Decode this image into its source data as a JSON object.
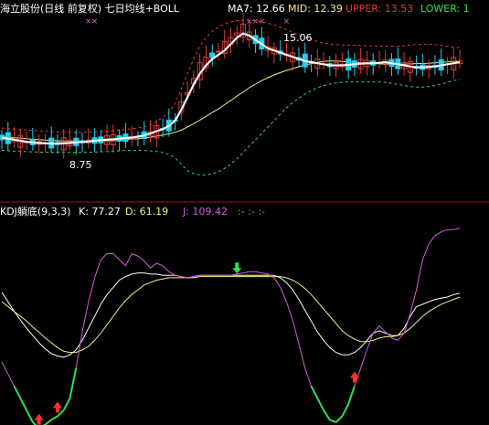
{
  "header": {
    "stock_title": "海立股份(日线 前复权) 七日均线+BOLL",
    "ma7": "MA7: 12.66",
    "mid": "MID: 12.39",
    "upper": "UPPER: 13.53",
    "lower": "LOWER: 1"
  },
  "sub_header": {
    "title": "KDJ躺底(9,3,3)",
    "k": "K: 77.27",
    "d": "D: 61.19",
    "j": "J: 109.42",
    "extra": ":- :- :-"
  },
  "annotations": {
    "high_label": "15.06",
    "low_label": "8.75"
  },
  "colors": {
    "up": "#e03a3a",
    "down": "#20d0f0",
    "ma7": "#ffffff",
    "mid": "#f0f080",
    "upper": "#e03a3a",
    "lower": "#30e050",
    "k": "#ffffff",
    "d": "#f0f080",
    "j": "#d85ad8",
    "j_low": "#30e050",
    "signal_up": "#ff3030",
    "signal_green": "#30e050"
  },
  "chart_data": [
    {
      "type": "candlestick",
      "title": "海立股份(日线 前复权) 七日均线+BOLL",
      "ylim": [
        7.0,
        15.6
      ],
      "series": [
        {
          "name": "MA7",
          "values": [
            9.9,
            9.85,
            9.8,
            9.75,
            9.7,
            9.68,
            9.65,
            9.63,
            9.62,
            9.62,
            9.63,
            9.65,
            9.68,
            9.7,
            9.72,
            9.75,
            9.78,
            9.8,
            9.82,
            9.85,
            9.88,
            9.9,
            9.95,
            10.0,
            10.1,
            10.2,
            10.3,
            10.45,
            10.7,
            11.2,
            11.8,
            12.4,
            12.9,
            13.3,
            13.6,
            13.8,
            14.0,
            14.3,
            14.6,
            14.8,
            14.7,
            14.5,
            14.3,
            14.1,
            14.0,
            13.9,
            13.8,
            13.7,
            13.6,
            13.5,
            13.45,
            13.4,
            13.35,
            13.3,
            13.3,
            13.3,
            13.32,
            13.35,
            13.38,
            13.4,
            13.4,
            13.42,
            13.45,
            13.4,
            13.35,
            13.3,
            13.25,
            13.2,
            13.2,
            13.22,
            13.25,
            13.3,
            13.35,
            13.4,
            13.45
          ]
        },
        {
          "name": "MID",
          "values": [
            9.95,
            9.92,
            9.9,
            9.88,
            9.85,
            9.82,
            9.8,
            9.78,
            9.76,
            9.75,
            9.74,
            9.73,
            9.72,
            9.72,
            9.72,
            9.73,
            9.74,
            9.75,
            9.76,
            9.78,
            9.8,
            9.82,
            9.85,
            9.88,
            9.92,
            9.97,
            10.02,
            10.08,
            10.15,
            10.25,
            10.4,
            10.55,
            10.72,
            10.9,
            11.08,
            11.25,
            11.45,
            11.65,
            11.85,
            12.05,
            12.25,
            12.42,
            12.58,
            12.72,
            12.85,
            12.96,
            13.06,
            13.15,
            13.24,
            13.32,
            13.38,
            13.44,
            13.48,
            13.5,
            13.5,
            13.48,
            13.46,
            13.44,
            13.42,
            13.4,
            13.38,
            13.37,
            13.36,
            13.36,
            13.36,
            13.36,
            13.37,
            13.38,
            13.39,
            13.4,
            13.42,
            13.44,
            13.46,
            13.48,
            13.5
          ]
        },
        {
          "name": "UPPER",
          "values": [
            10.35,
            10.32,
            10.3,
            10.28,
            10.26,
            10.24,
            10.22,
            10.2,
            10.18,
            10.17,
            10.16,
            10.15,
            10.15,
            10.15,
            10.16,
            10.17,
            10.18,
            10.2,
            10.22,
            10.25,
            10.28,
            10.32,
            10.36,
            10.4,
            10.5,
            10.65,
            10.85,
            11.1,
            11.5,
            12.2,
            12.9,
            13.6,
            14.2,
            14.6,
            14.9,
            15.1,
            15.25,
            15.35,
            15.4,
            15.42,
            15.42,
            15.4,
            15.35,
            15.28,
            15.2,
            15.1,
            14.98,
            14.85,
            14.72,
            14.6,
            14.5,
            14.42,
            14.35,
            14.3,
            14.28,
            14.26,
            14.25,
            14.24,
            14.23,
            14.22,
            14.21,
            14.2,
            14.2,
            14.2,
            14.2,
            14.22,
            14.25,
            14.28,
            14.3,
            14.3,
            14.28,
            14.24,
            14.2,
            14.16,
            14.13
          ]
        },
        {
          "name": "LOWER",
          "values": [
            9.3,
            9.28,
            9.26,
            9.25,
            9.24,
            9.23,
            9.22,
            9.21,
            9.2,
            9.2,
            9.2,
            9.2,
            9.2,
            9.2,
            9.21,
            9.22,
            9.23,
            9.24,
            9.26,
            9.28,
            9.3,
            9.3,
            9.3,
            9.3,
            9.28,
            9.25,
            9.2,
            9.1,
            8.95,
            8.65,
            8.35,
            8.2,
            8.15,
            8.15,
            8.2,
            8.3,
            8.45,
            8.65,
            8.9,
            9.2,
            9.5,
            9.8,
            10.1,
            10.4,
            10.7,
            11.0,
            11.3,
            11.55,
            11.75,
            11.95,
            12.1,
            12.25,
            12.35,
            12.42,
            12.47,
            12.5,
            12.52,
            12.52,
            12.52,
            12.52,
            12.52,
            12.52,
            12.5,
            12.45,
            12.4,
            12.35,
            12.3,
            12.28,
            12.28,
            12.3,
            12.35,
            12.42,
            12.5,
            12.58,
            12.63
          ]
        }
      ]
    },
    {
      "type": "line",
      "title": "KDJ躺底(9,3,3)",
      "ylim": [
        -30,
        140
      ],
      "series": [
        {
          "name": "K",
          "values": [
            78,
            70,
            62,
            55,
            48,
            42,
            36,
            31,
            27,
            25,
            24,
            26,
            30,
            38,
            48,
            58,
            68,
            76,
            82,
            88,
            91,
            93,
            94,
            94,
            93,
            93,
            92,
            92,
            92,
            91,
            90,
            91,
            92,
            92,
            92,
            92,
            92,
            92,
            92,
            92,
            92,
            92,
            92,
            92,
            92,
            90,
            86,
            80,
            72,
            63,
            54,
            45,
            38,
            32,
            28,
            26,
            26,
            28,
            32,
            38,
            44,
            46,
            44,
            42,
            42,
            48,
            58,
            66,
            68,
            70,
            72,
            73,
            74,
            76,
            77
          ]
        },
        {
          "name": "D",
          "values": [
            70,
            66,
            62,
            58,
            54,
            49,
            45,
            40,
            36,
            32,
            29,
            28,
            28,
            30,
            33,
            38,
            44,
            51,
            58,
            65,
            71,
            76,
            80,
            84,
            86,
            88,
            89,
            90,
            90,
            90,
            90,
            90,
            91,
            91,
            91,
            91,
            91,
            91,
            91,
            91,
            91,
            91,
            91,
            91,
            91,
            91,
            90,
            88,
            85,
            81,
            76,
            70,
            64,
            58,
            52,
            46,
            42,
            39,
            37,
            37,
            38,
            40,
            41,
            41,
            42,
            44,
            48,
            53,
            58,
            62,
            65,
            68,
            70,
            72,
            74
          ]
        },
        {
          "name": "J",
          "values": [
            20,
            10,
            0,
            -10,
            -20,
            -30,
            -35,
            -32,
            -28,
            -25,
            -20,
            -10,
            15,
            45,
            70,
            90,
            105,
            110,
            110,
            105,
            100,
            110,
            108,
            104,
            98,
            102,
            100,
            95,
            92,
            91,
            90,
            91,
            92,
            92,
            92,
            92,
            92,
            92,
            93,
            94,
            95,
            95,
            94,
            93,
            90,
            82,
            70,
            55,
            35,
            15,
            0,
            -10,
            -20,
            -28,
            -30,
            -25,
            -15,
            0,
            15,
            30,
            44,
            50,
            45,
            40,
            38,
            44,
            60,
            80,
            105,
            118,
            125,
            128,
            130,
            130,
            131
          ]
        }
      ]
    }
  ]
}
